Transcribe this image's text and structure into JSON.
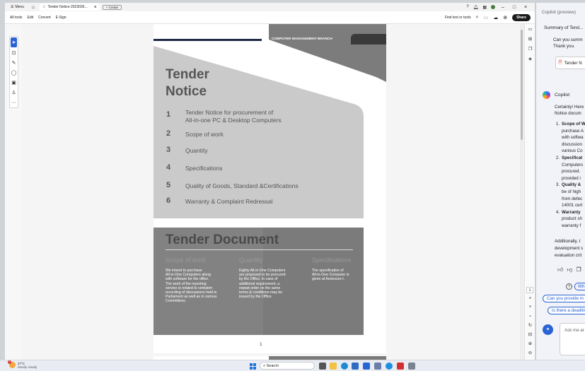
{
  "window": {
    "menu_label": "Menu",
    "tab_title": "Tender Notice-2023030...",
    "create_label": "Create"
  },
  "toolbar": {
    "items": [
      "All tools",
      "Edit",
      "Convert",
      "E-Sign"
    ],
    "find_label": "Find text or tools",
    "share_label": "Share"
  },
  "document": {
    "header_band": "COMPUTER MANAGEMENT BRANCH",
    "title_line1": "Tender",
    "title_line2": "Notice",
    "contents": [
      {
        "num": "1",
        "text": "Tender Notice for procurement of",
        "text2": "All-in-one PC & Desktop Computers"
      },
      {
        "num": "2",
        "text": "Scope of work"
      },
      {
        "num": "3",
        "text": "Quantity"
      },
      {
        "num": "4",
        "text": "Specifications"
      },
      {
        "num": "5",
        "text": "Quality of Goods, Standard &Certifications"
      },
      {
        "num": "6",
        "text": "Warranty & Complaint Redressal"
      }
    ],
    "doc_title": "Tender Document",
    "columns": [
      {
        "heading": "Scope of work",
        "lines": [
          "We intend to purchase",
          "All-in-One Computers along",
          "with software for the office.",
          "The work of the reporting",
          "service is related to verbatim",
          "recording of discussions held in",
          "Parliament as well as in various",
          "Committees."
        ]
      },
      {
        "heading": "Quantity",
        "lines": [
          "Eighty All-in-One Computers",
          "are proposed to be procured",
          "by the Office. In case of",
          "additional requirement, a",
          "repeat order on the same",
          "terms & conditions may be",
          "issued by the Office."
        ]
      },
      {
        "heading": "Specifications",
        "lines": [
          "The specification of",
          "All-in-One Computer is",
          "given at Annexure-I."
        ]
      }
    ],
    "page_number": "1",
    "page_indicator": "1"
  },
  "copilot": {
    "title": "Copilot (preview)",
    "summary_heading": "Summary of Tend...",
    "user_msg_line1": "Can you summ",
    "user_msg_line2": "Thank you.",
    "file_chip": "Tender N",
    "assistant_name": "Copilot",
    "response_line1": "Certainly! Here",
    "response_line2": "Notice docum",
    "list": [
      {
        "num": "1.",
        "bold": "Scope of W",
        "lines": [
          "purchase A",
          "with softwa",
          "discussion",
          "various Co"
        ]
      },
      {
        "num": "2.",
        "bold": "Specificat",
        "lines": [
          "Computers",
          "procured.",
          "provided i"
        ]
      },
      {
        "num": "3.",
        "bold": "Quality &",
        "lines": [
          "be of high",
          "from defec",
          "14001 cert"
        ]
      },
      {
        "num": "4.",
        "bold": "Warranty",
        "lines": [
          "product sh",
          "warranty f"
        ]
      }
    ],
    "additional_lines": [
      "Additionally, t",
      "development s",
      "evaluation crit"
    ],
    "help_chip": "Wh",
    "suggestion1": "Can you provide m",
    "suggestion2": "Is there a deadlin",
    "input_placeholder": "Ask me ar"
  },
  "taskbar": {
    "temp": "27°C",
    "weather": "Mostly cloudy",
    "badge": "1",
    "search_label": "Search"
  },
  "colors": {
    "accent": "#2a63d4",
    "doc_grey": "#c9c9c9",
    "doc_dark": "#7b7b7b"
  }
}
